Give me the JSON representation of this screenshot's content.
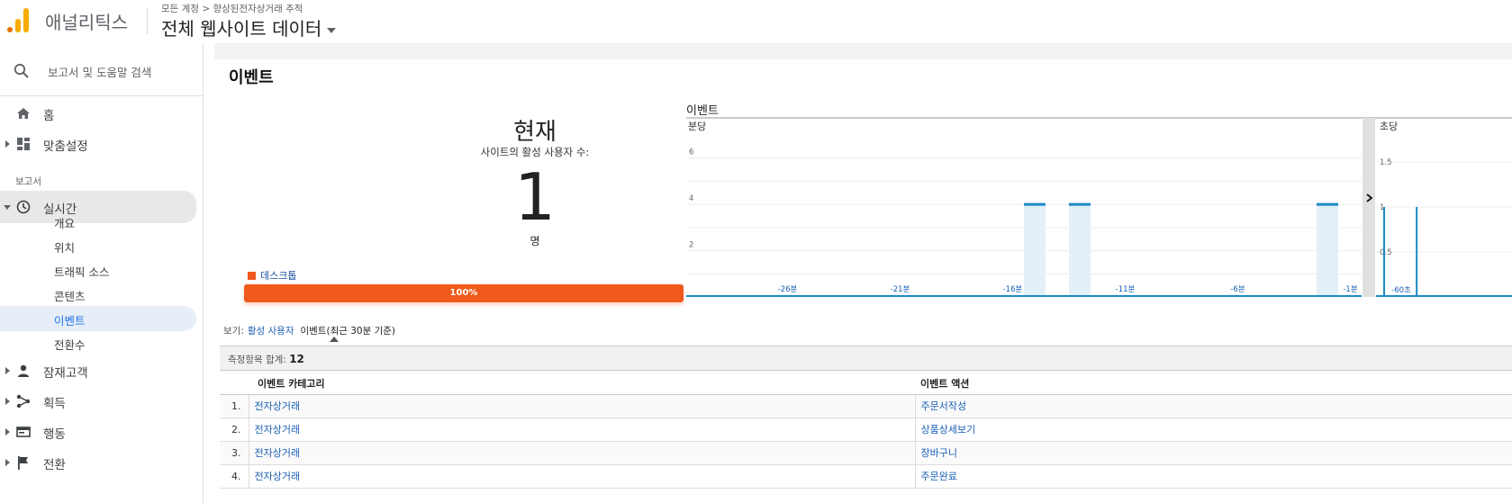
{
  "header": {
    "app_name": "애널리틱스",
    "breadcrumb": "모든 계정 > 향상된전자상거래 추적",
    "view_title": "전체 웹사이트 데이터"
  },
  "sidebar": {
    "search_placeholder": "보고서 및 도움말 검색",
    "home": "홈",
    "customization": "맞춤설정",
    "reports_label": "보고서",
    "realtime": "실시간",
    "realtime_items": [
      "개요",
      "위치",
      "트래픽 소스",
      "콘텐츠",
      "이벤트",
      "전환수"
    ],
    "audience": "잠재고객",
    "acquisition": "획득",
    "behavior": "행동",
    "conversions": "전환"
  },
  "main": {
    "title": "이벤트",
    "now_title": "현재",
    "now_sub": "사이트의 활성 사용자 수:",
    "now_value": "1",
    "now_unit": "명",
    "device_legend": "데스크톱",
    "device_bar_label": "100%",
    "view_prefix": "보기:",
    "view_link": "활성 사용자",
    "view_current": "이벤트(최근 30분 기준)",
    "total_label": "측정항목 합계:",
    "total_value": "12",
    "table": {
      "headers": [
        "이벤트 카테고리",
        "이벤트 액션"
      ],
      "rows": [
        {
          "num": "1.",
          "category": "전자상거래",
          "action": "주문서작성"
        },
        {
          "num": "2.",
          "category": "전자상거래",
          "action": "상품상세보기"
        },
        {
          "num": "3.",
          "category": "전자상거래",
          "action": "장바구니"
        },
        {
          "num": "4.",
          "category": "전자상거래",
          "action": "주문완료"
        }
      ]
    }
  },
  "chart_data": [
    {
      "type": "bar",
      "title": "이벤트",
      "subtitle": "분당",
      "y_ticks": [
        2,
        4,
        6
      ],
      "x_tick_labels": [
        "-26분",
        "-21분",
        "-16분",
        "-11분",
        "-6분",
        "-1분"
      ],
      "x_minutes": [
        -30,
        -29,
        -28,
        -27,
        -26,
        -25,
        -24,
        -23,
        -22,
        -21,
        -20,
        -19,
        -18,
        -17,
        -16,
        -15,
        -14,
        -13,
        -12,
        -11,
        -10,
        -9,
        -8,
        -7,
        -6,
        -5,
        -4,
        -3,
        -2,
        -1
      ],
      "values": [
        0,
        0,
        0,
        0,
        0,
        0,
        0,
        0,
        0,
        0,
        0,
        0,
        0,
        0,
        0,
        4,
        0,
        4,
        0,
        0,
        0,
        0,
        0,
        0,
        0,
        0,
        0,
        0,
        4,
        0
      ],
      "ylim": [
        0,
        7
      ],
      "colors": {
        "bar_fill": "#e3f0f8",
        "bar_top": "#1a8ac7"
      }
    },
    {
      "type": "bar",
      "subtitle": "초당",
      "y_ticks": [
        0.5,
        1,
        1.5
      ],
      "x_tick_labels": [
        "-60초"
      ],
      "spikes_at": [
        -58,
        -50
      ],
      "spike_value": 1,
      "ylim": [
        0,
        1.8
      ],
      "colors": {
        "bar": "#1a8ac7"
      }
    }
  ],
  "colors": {
    "accent": "#ef5a1c",
    "link": "#1a5fb4",
    "chart_line": "#1a8ac7"
  }
}
